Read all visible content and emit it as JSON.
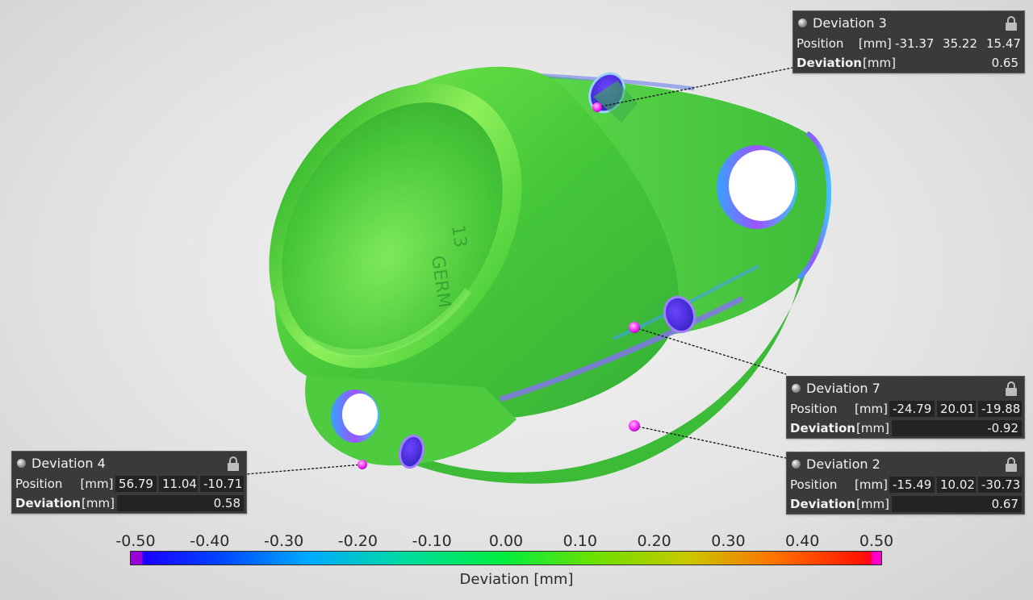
{
  "viewport": {
    "deviation_panels": [
      {
        "title": "Deviation 3",
        "position_label": "Position",
        "unit_label": "[mm]",
        "position": [
          "-31.37",
          "35.22",
          "15.47"
        ],
        "deviation_label": "Deviation",
        "deviation": "0.65"
      },
      {
        "title": "Deviation 7",
        "position_label": "Position",
        "unit_label": "[mm]",
        "position": [
          "-24.79",
          "20.01",
          "-19.88"
        ],
        "deviation_label": "Deviation",
        "deviation": "-0.92"
      },
      {
        "title": "Deviation 2",
        "position_label": "Position",
        "unit_label": "[mm]",
        "position": [
          "-15.49",
          "10.02",
          "-30.73"
        ],
        "deviation_label": "Deviation",
        "deviation": "0.67"
      },
      {
        "title": "Deviation 4",
        "position_label": "Position",
        "unit_label": "[mm]",
        "position": [
          "56.79",
          "11.04",
          "-10.71"
        ],
        "deviation_label": "Deviation",
        "deviation": "0.58"
      }
    ],
    "model_engraving": [
      "13",
      "GERM"
    ]
  },
  "colorbar": {
    "title": "Deviation [mm]",
    "ticks": [
      "-0.50",
      "-0.40",
      "-0.30",
      "-0.20",
      "-0.10",
      "0.00",
      "0.10",
      "0.20",
      "0.30",
      "0.40",
      "0.50"
    ],
    "range": [
      -0.5,
      0.5
    ],
    "colors": {
      "min_overflow": "#9a00d8",
      "low": "#1a00ff",
      "mid": "#00ee40",
      "high": "#ff1500",
      "max_overflow": "#ff00c8"
    }
  },
  "icons": {
    "panel_status": "sphere-icon",
    "panel_lock": "lock-icon"
  }
}
